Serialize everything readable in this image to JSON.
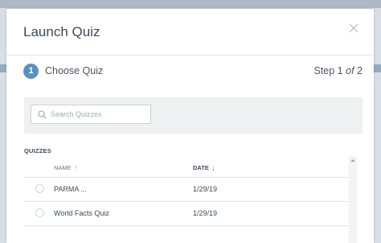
{
  "dialog": {
    "title": "Launch Quiz"
  },
  "stepper": {
    "number": "1",
    "label": "Choose Quiz",
    "count_prefix": "Step 1 ",
    "count_of": "of",
    "count_total": " 2"
  },
  "search": {
    "placeholder": "Search Quizzes",
    "value": ""
  },
  "quizzes": {
    "section_label": "QUIZZES",
    "columns": {
      "name": "NAME",
      "date": "DATE"
    },
    "sort": {
      "name_arrow": "↑",
      "date_arrow": "↓"
    },
    "rows": [
      {
        "name": "PARMA ...",
        "date": "1/29/19"
      },
      {
        "name": "World Facts Quiz",
        "date": "1/29/19"
      }
    ]
  },
  "icons": {
    "close": "close-icon",
    "search": "search-icon"
  },
  "colors": {
    "accent": "#5b8fc4",
    "panel": "#eef0f2",
    "backdrop": "#c9d3dd"
  }
}
